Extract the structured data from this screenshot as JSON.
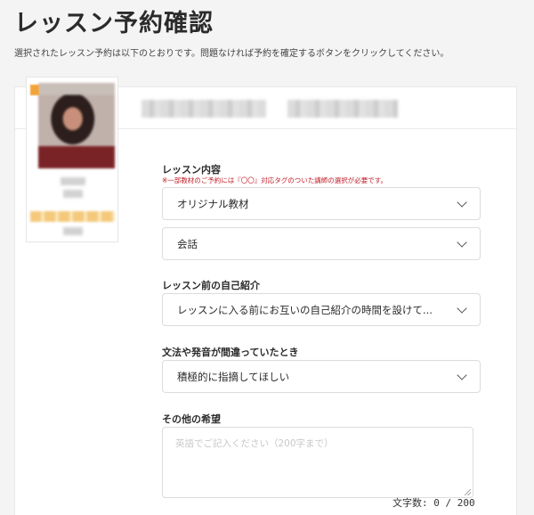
{
  "page": {
    "title": "レッスン予約確認",
    "description": "選択されたレッスン予約は以下のとおりです。問題なければ予約を確定するボタンをクリックしてください。"
  },
  "form": {
    "lesson_content": {
      "label": "レッスン内容",
      "note": "※一部教材のご予約には『〇〇』対応タグのついた講師の選択が必要です。",
      "material_value": "オリジナル教材",
      "topic_value": "会話"
    },
    "self_intro": {
      "label": "レッスン前の自己紹介",
      "value": "レッスンに入る前にお互いの自己紹介の時間を設けて..."
    },
    "correction": {
      "label": "文法や発音が間違っていたとき",
      "value": "積極的に指摘してほしい"
    },
    "other_requests": {
      "label": "その他の希望",
      "placeholder": "英語でご記入ください（200字まで）",
      "counter": "文字数: 0 / 200"
    }
  },
  "colors": {
    "note": "#c2202a",
    "background": "#f4f4f4"
  },
  "icons": {
    "select_arrow": "chevron-down-icon"
  }
}
